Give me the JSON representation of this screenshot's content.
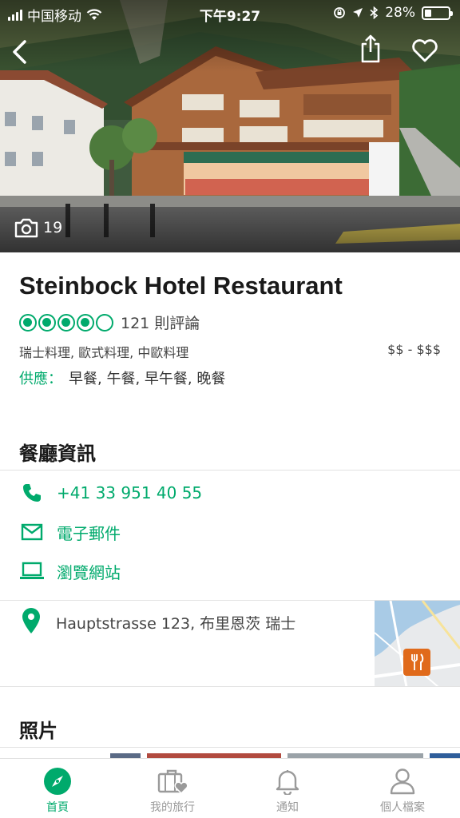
{
  "status_bar": {
    "carrier": "中国移动",
    "time": "下午9:27",
    "battery_percent": "28%",
    "battery_level": 0.28
  },
  "hero": {
    "photo_count": "19"
  },
  "restaurant": {
    "name": "Steinbock Hotel Restaurant",
    "rating_bubbles": 4,
    "rating_max": 5,
    "review_count": "121 則評論",
    "cuisines": "瑞士料理, 歐式料理, 中歐料理",
    "price_range": "$$ - $$$",
    "serves_label": "供應：",
    "serves_value": "早餐, 午餐, 早午餐, 晚餐"
  },
  "info_section": {
    "title": "餐廳資訊",
    "phone": "+41 33 951 40 55",
    "email_label": "電子郵件",
    "website_label": "瀏覽網站",
    "address": "Hauptstrasse 123, 布里恩茨 瑞士"
  },
  "photos_section": {
    "title": "照片"
  },
  "tabbar": {
    "tabs": [
      {
        "label": "首頁",
        "icon": "compass-icon",
        "active": true
      },
      {
        "label": "我的旅行",
        "icon": "suitcase-heart-icon",
        "active": false
      },
      {
        "label": "通知",
        "icon": "bell-icon",
        "active": false
      },
      {
        "label": "個人檔案",
        "icon": "person-icon",
        "active": false
      }
    ]
  },
  "colors": {
    "accent": "#00aa6c",
    "map_marker": "#e06a1b"
  }
}
